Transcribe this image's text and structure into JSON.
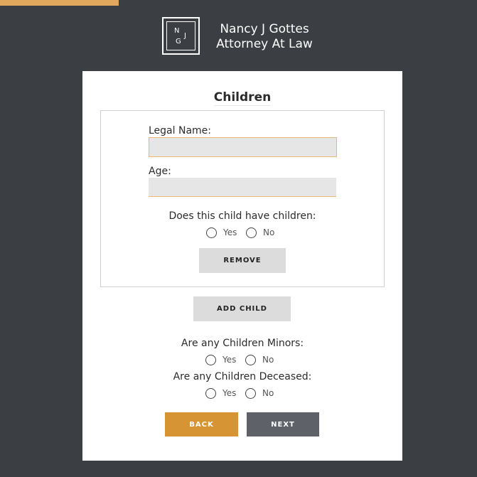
{
  "header": {
    "logo_letters": [
      "N",
      "J",
      "G"
    ],
    "brand_line1": "Nancy J Gottes",
    "brand_line2": "Attorney At Law"
  },
  "form": {
    "title": "Children",
    "child": {
      "legal_name_label": "Legal Name:",
      "legal_name_value": "",
      "age_label": "Age:",
      "age_value": "",
      "has_children_question": "Does this child have children:",
      "yes_label": "Yes",
      "no_label": "No",
      "remove_label": "REMOVE"
    },
    "add_child_label": "ADD CHILD",
    "minors_question": "Are any Children Minors:",
    "deceased_question": "Are any Children Deceased:",
    "yes_label": "Yes",
    "no_label": "No",
    "back_label": "BACK",
    "next_label": "NEXT"
  },
  "colors": {
    "background": "#3b3e42",
    "accent": "#d79434",
    "next_button": "#5e6268",
    "focus_border": "#e9b86e"
  }
}
